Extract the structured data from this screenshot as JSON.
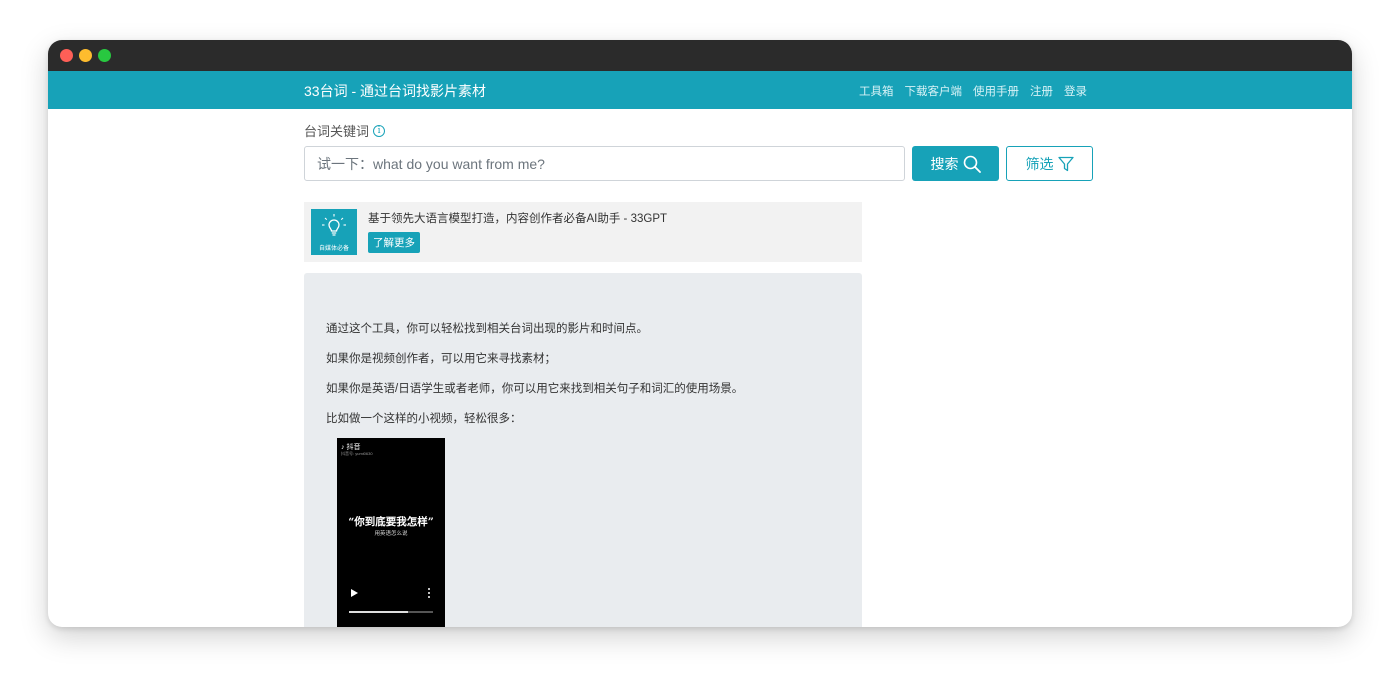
{
  "navbar": {
    "brand": "33台词 - 通过台词找影片素材",
    "links": [
      "工具箱",
      "下载客户端",
      "使用手册",
      "注册",
      "登录"
    ]
  },
  "search": {
    "label": "台词关键词",
    "placeholder": "试一下：what do you want from me?",
    "search_button": "搜索",
    "filter_button": "筛选"
  },
  "ad": {
    "logo_text": "自媒体必备",
    "text": "基于领先大语言模型打造，内容创作者必备AI助手 - 33GPT",
    "button": "了解更多"
  },
  "intro": {
    "lines": [
      "通过这个工具，你可以轻松找到相关台词出现的影片和时间点。",
      "如果你是视频创作者，可以用它来寻找素材；",
      "如果你是英语/日语学生或者老师，你可以用它来找到相关句子和词汇的使用场景。",
      "比如做一个这样的小视频，轻松很多："
    ],
    "video": {
      "app_name": "抖音",
      "account": "抖音号: yumi0630",
      "title": "“你到底要我怎样”",
      "subtitle": "用英语怎么说",
      "progress": 0.7
    }
  },
  "colors": {
    "accent": "#17a2b8"
  }
}
